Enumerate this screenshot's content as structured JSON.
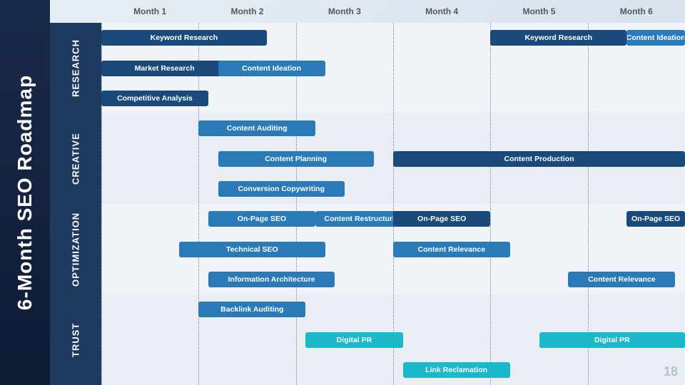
{
  "title": "6-Month SEO Roadmap",
  "months": [
    "Month 1",
    "Month 2",
    "Month 3",
    "Month 4",
    "Month 5",
    "Month 6"
  ],
  "sections": [
    {
      "id": "research",
      "label": "Research"
    },
    {
      "id": "creative",
      "label": "Creative"
    },
    {
      "id": "optimization",
      "label": "Optimization"
    },
    {
      "id": "trust",
      "label": "Trust"
    }
  ],
  "bars": [
    {
      "section": "research",
      "label": "Keyword Research",
      "col_start": 0,
      "col_end": 1.7,
      "row": 0,
      "type": "dark"
    },
    {
      "section": "research",
      "label": "Market Research",
      "col_start": 0,
      "col_end": 1.3,
      "row": 1,
      "type": "dark"
    },
    {
      "section": "research",
      "label": "Content Ideation",
      "col_start": 1.2,
      "col_end": 2.3,
      "row": 1,
      "type": "mid"
    },
    {
      "section": "research",
      "label": "Competitive Analysis",
      "col_start": 0,
      "col_end": 1.1,
      "row": 2,
      "type": "dark"
    },
    {
      "section": "research",
      "label": "Keyword Research",
      "col_start": 4.0,
      "col_end": 5.4,
      "row": 0,
      "type": "dark"
    },
    {
      "section": "research",
      "label": "Content Ideation",
      "col_start": 5.4,
      "col_end": 6.0,
      "row": 0,
      "type": "mid"
    },
    {
      "section": "creative",
      "label": "Content Auditing",
      "col_start": 1.0,
      "col_end": 2.2,
      "row": 0,
      "type": "mid"
    },
    {
      "section": "creative",
      "label": "Content Planning",
      "col_start": 1.2,
      "col_end": 2.8,
      "row": 1,
      "type": "mid"
    },
    {
      "section": "creative",
      "label": "Conversion Copywriting",
      "col_start": 1.2,
      "col_end": 2.5,
      "row": 2,
      "type": "mid"
    },
    {
      "section": "creative",
      "label": "Content Production",
      "col_start": 3.0,
      "col_end": 6.0,
      "row": 1,
      "type": "dark"
    },
    {
      "section": "optimization",
      "label": "On-Page SEO",
      "col_start": 1.1,
      "col_end": 2.2,
      "row": 0,
      "type": "mid"
    },
    {
      "section": "optimization",
      "label": "Content Restructuring",
      "col_start": 2.2,
      "col_end": 3.2,
      "row": 0,
      "type": "mid"
    },
    {
      "section": "optimization",
      "label": "Technical SEO",
      "col_start": 0.8,
      "col_end": 2.3,
      "row": 1,
      "type": "mid"
    },
    {
      "section": "optimization",
      "label": "Content Relevance",
      "col_start": 3.0,
      "col_end": 4.2,
      "row": 1,
      "type": "mid"
    },
    {
      "section": "optimization",
      "label": "Information Architecture",
      "col_start": 1.1,
      "col_end": 2.4,
      "row": 2,
      "type": "mid"
    },
    {
      "section": "optimization",
      "label": "On-Page SEO",
      "col_start": 3.0,
      "col_end": 4.0,
      "row": 0,
      "type": "dark"
    },
    {
      "section": "optimization",
      "label": "Content Relevance",
      "col_start": 4.8,
      "col_end": 5.9,
      "row": 2,
      "type": "mid"
    },
    {
      "section": "optimization",
      "label": "On-Page SEO",
      "col_start": 5.4,
      "col_end": 6.0,
      "row": 0,
      "type": "dark"
    },
    {
      "section": "trust",
      "label": "Backlink Auditing",
      "col_start": 1.0,
      "col_end": 2.1,
      "row": 0,
      "type": "mid"
    },
    {
      "section": "trust",
      "label": "Digital PR",
      "col_start": 2.1,
      "col_end": 3.1,
      "row": 1,
      "type": "teal"
    },
    {
      "section": "trust",
      "label": "Link Reclamation",
      "col_start": 3.1,
      "col_end": 4.2,
      "row": 2,
      "type": "teal"
    },
    {
      "section": "trust",
      "label": "Digital PR",
      "col_start": 4.5,
      "col_end": 6.0,
      "row": 1,
      "type": "teal"
    }
  ],
  "watermark": "18"
}
